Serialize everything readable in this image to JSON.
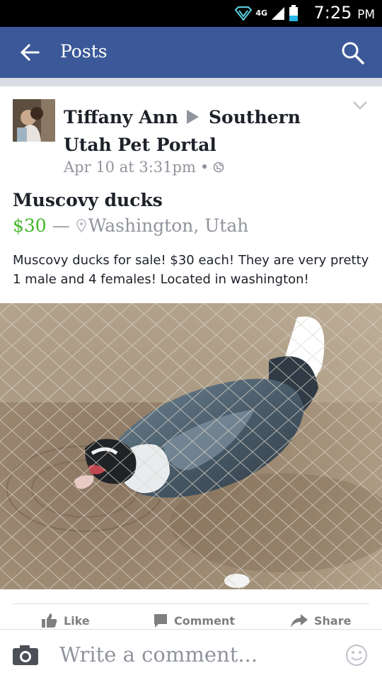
{
  "status_bar": {
    "network": "4G",
    "time": "7:25",
    "ampm": "PM"
  },
  "app_bar": {
    "title": "Posts"
  },
  "post": {
    "author": "Tiffany Ann",
    "group": "Southern Utah Pet Portal",
    "timestamp": "Apr 10 at 3:31pm",
    "separator": "•",
    "item_title": "Muscovy ducks",
    "price": "$30",
    "dash": "—",
    "location": "Washington, Utah",
    "description": "Muscovy ducks for sale! $30 each! They are very pretty 1 male and 4 females! Located in washington!"
  },
  "actions": {
    "like": "Like",
    "comment": "Comment",
    "share": "Share"
  },
  "comment_bar": {
    "placeholder": "Write a comment..."
  },
  "colors": {
    "brand": "#3b5998",
    "price_green": "#42b72a",
    "muted": "#90949c"
  }
}
